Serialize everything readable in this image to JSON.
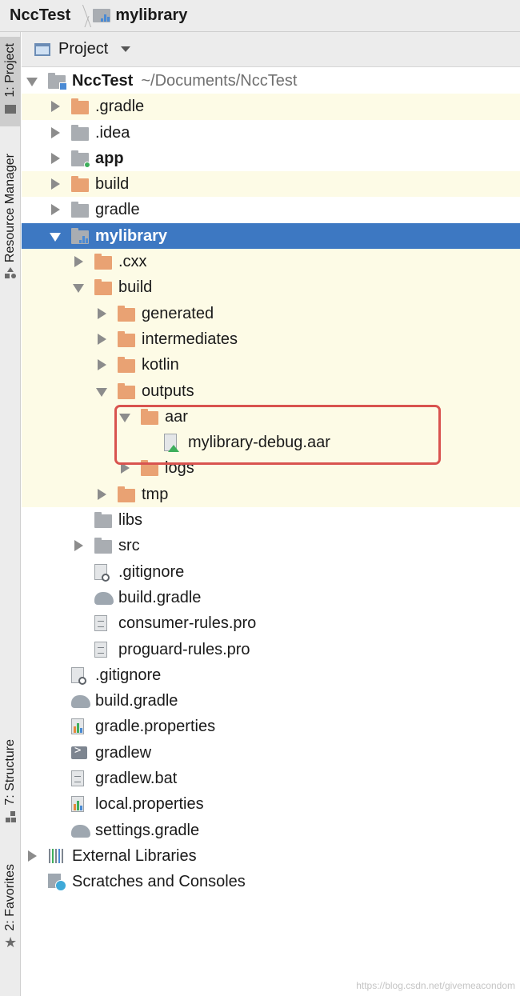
{
  "breadcrumb": {
    "project": "NccTest",
    "module": "mylibrary"
  },
  "side_tabs": {
    "project": "1: Project",
    "resource_manager": "Resource Manager",
    "structure": "7: Structure",
    "favorites": "2: Favorites"
  },
  "project_view": {
    "title": "Project"
  },
  "tree": [
    {
      "label": "NccTest",
      "hint": "~/Documents/NccTest",
      "bold": true,
      "depth": 0,
      "arrow": "down",
      "icon": "project-module",
      "bg": "white"
    },
    {
      "label": ".gradle",
      "depth": 1,
      "arrow": "right",
      "icon": "folder-orange",
      "bg": "yellow"
    },
    {
      "label": ".idea",
      "depth": 1,
      "arrow": "right",
      "icon": "folder-gray",
      "bg": "white"
    },
    {
      "label": "app",
      "bold": true,
      "depth": 1,
      "arrow": "right",
      "icon": "app-module",
      "bg": "white"
    },
    {
      "label": "build",
      "depth": 1,
      "arrow": "right",
      "icon": "folder-orange",
      "bg": "yellow"
    },
    {
      "label": "gradle",
      "depth": 1,
      "arrow": "right",
      "icon": "folder-gray",
      "bg": "white"
    },
    {
      "label": "mylibrary",
      "bold": true,
      "depth": 1,
      "arrow": "down",
      "icon": "library-module",
      "bg": "selected"
    },
    {
      "label": ".cxx",
      "depth": 2,
      "arrow": "right",
      "icon": "folder-orange",
      "bg": "yellow"
    },
    {
      "label": "build",
      "depth": 2,
      "arrow": "down",
      "icon": "folder-orange",
      "bg": "yellow"
    },
    {
      "label": "generated",
      "depth": 3,
      "arrow": "right",
      "icon": "folder-orange",
      "bg": "yellow"
    },
    {
      "label": "intermediates",
      "depth": 3,
      "arrow": "right",
      "icon": "folder-orange",
      "bg": "yellow"
    },
    {
      "label": "kotlin",
      "depth": 3,
      "arrow": "right",
      "icon": "folder-orange",
      "bg": "yellow"
    },
    {
      "label": "outputs",
      "depth": 3,
      "arrow": "down",
      "icon": "folder-orange",
      "bg": "yellow"
    },
    {
      "label": "aar",
      "depth": 4,
      "arrow": "down",
      "icon": "folder-orange",
      "bg": "yellow"
    },
    {
      "label": "mylibrary-debug.aar",
      "depth": 5,
      "arrow": "none",
      "icon": "aar-file",
      "bg": "yellow"
    },
    {
      "label": "logs",
      "depth": 4,
      "arrow": "right",
      "icon": "folder-orange",
      "bg": "yellow"
    },
    {
      "label": "tmp",
      "depth": 3,
      "arrow": "right",
      "icon": "folder-orange",
      "bg": "yellow"
    },
    {
      "label": "libs",
      "depth": 2,
      "arrow": "none",
      "icon": "folder-gray",
      "bg": "white"
    },
    {
      "label": "src",
      "depth": 2,
      "arrow": "right",
      "icon": "folder-gray",
      "bg": "white"
    },
    {
      "label": ".gitignore",
      "depth": 2,
      "arrow": "none",
      "icon": "gitignore-file",
      "bg": "white"
    },
    {
      "label": "build.gradle",
      "depth": 2,
      "arrow": "none",
      "icon": "gradle-file",
      "bg": "white"
    },
    {
      "label": "consumer-rules.pro",
      "depth": 2,
      "arrow": "none",
      "icon": "text-file",
      "bg": "white"
    },
    {
      "label": "proguard-rules.pro",
      "depth": 2,
      "arrow": "none",
      "icon": "text-file",
      "bg": "white"
    },
    {
      "label": ".gitignore",
      "depth": 1,
      "arrow": "none",
      "icon": "gitignore-file",
      "bg": "white"
    },
    {
      "label": "build.gradle",
      "depth": 1,
      "arrow": "none",
      "icon": "gradle-file",
      "bg": "white"
    },
    {
      "label": "gradle.properties",
      "depth": 1,
      "arrow": "none",
      "icon": "properties-file",
      "bg": "white"
    },
    {
      "label": "gradlew",
      "depth": 1,
      "arrow": "none",
      "icon": "terminal-file",
      "bg": "white"
    },
    {
      "label": "gradlew.bat",
      "depth": 1,
      "arrow": "none",
      "icon": "text-file",
      "bg": "white"
    },
    {
      "label": "local.properties",
      "depth": 1,
      "arrow": "none",
      "icon": "properties-file",
      "bg": "white"
    },
    {
      "label": "settings.gradle",
      "depth": 1,
      "arrow": "none",
      "icon": "gradle-file",
      "bg": "white"
    },
    {
      "label": "External Libraries",
      "depth": 0,
      "arrow": "right",
      "icon": "libraries",
      "bg": "white"
    },
    {
      "label": "Scratches and Consoles",
      "depth": 0,
      "arrow": "none",
      "icon": "scratches",
      "bg": "white"
    }
  ],
  "watermark": "https://blog.csdn.net/givemeacondom",
  "colors": {
    "selection": "#3d78c2",
    "excluded_bg": "#fdfbe6",
    "folder_orange": "#e9a273",
    "folder_gray": "#a9adb2",
    "highlight": "#d9534f"
  }
}
